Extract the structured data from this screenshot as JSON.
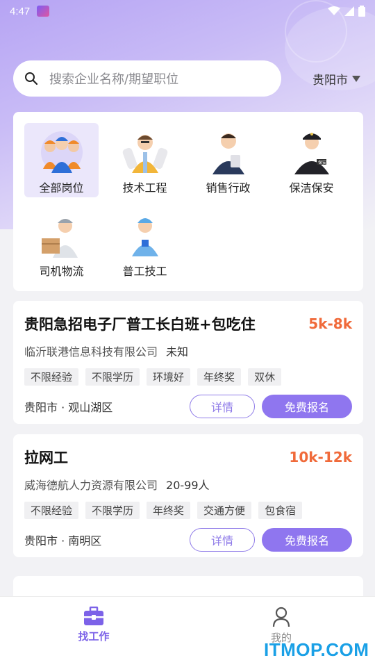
{
  "status_bar": {
    "time": "4:47"
  },
  "search": {
    "placeholder": "搜索企业名称/期望职位",
    "city": "贵阳市"
  },
  "categories": [
    {
      "label": "全部岗位",
      "icon": "workers-group-icon",
      "active": true
    },
    {
      "label": "技术工程",
      "icon": "engineer-icon",
      "active": false
    },
    {
      "label": "销售行政",
      "icon": "sales-suit-icon",
      "active": false
    },
    {
      "label": "保洁保安",
      "icon": "security-guard-icon",
      "active": false
    },
    {
      "label": "司机物流",
      "icon": "courier-icon",
      "active": false
    },
    {
      "label": "普工技工",
      "icon": "technician-icon",
      "active": false
    }
  ],
  "jobs": [
    {
      "title": "贵阳急招电子厂普工长白班+包吃住",
      "salary": "5k-8k",
      "company": "临沂联港信息科技有限公司",
      "size": "未知",
      "tags": [
        "不限经验",
        "不限学历",
        "环境好",
        "年终奖",
        "双休"
      ],
      "location": "贵阳市 · 观山湖区",
      "detail_label": "详情",
      "apply_label": "免费报名"
    },
    {
      "title": "拉网工",
      "salary": "10k-12k",
      "company": "威海德航人力资源有限公司",
      "size": "20-99人",
      "tags": [
        "不限经验",
        "不限学历",
        "年终奖",
        "交通方便",
        "包食宿"
      ],
      "location": "贵阳市 · 南明区",
      "detail_label": "详情",
      "apply_label": "免费报名"
    }
  ],
  "bottom_nav": [
    {
      "label": "找工作",
      "icon": "briefcase-icon",
      "active": true
    },
    {
      "label": "我的",
      "icon": "person-icon",
      "active": false
    }
  ],
  "watermark": "ITMOP.COM",
  "colors": {
    "accent": "#8f76ef",
    "salary": "#f06a3a"
  }
}
